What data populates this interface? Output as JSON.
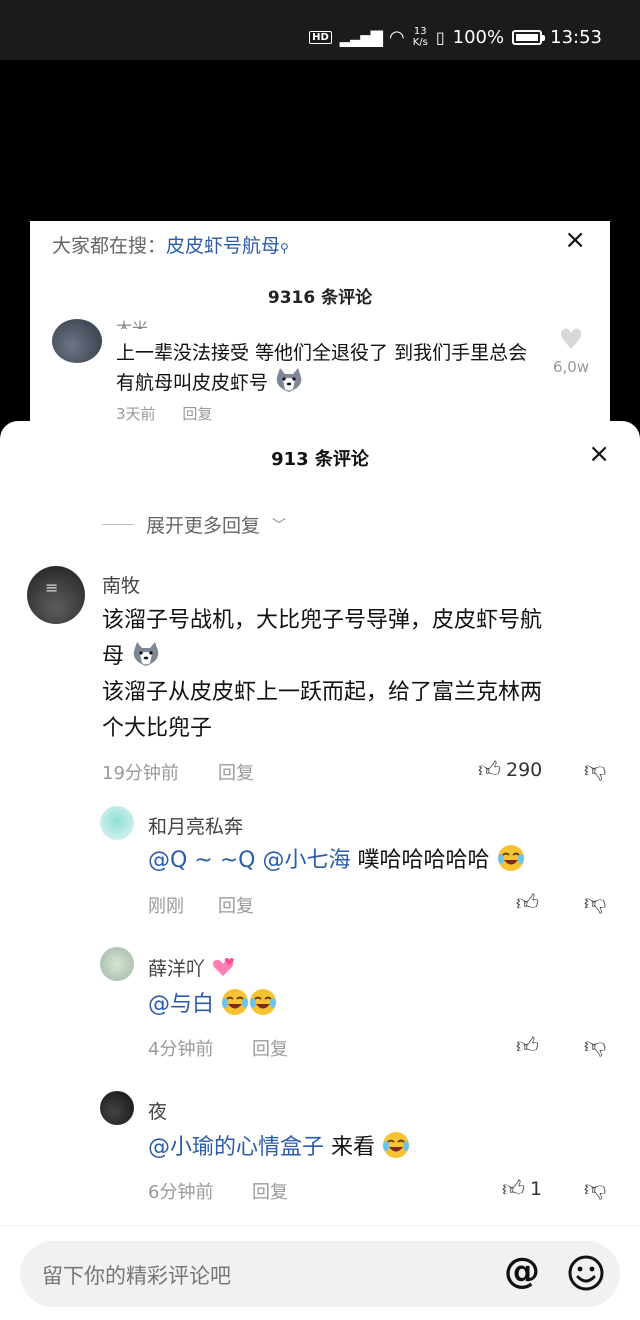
{
  "status_bar": {
    "hd": "HD",
    "signal": "5G",
    "speed_value": "13",
    "speed_unit": "K/s",
    "battery": "100%",
    "time": "13:53"
  },
  "under_panel": {
    "search_label": "大家都在搜：",
    "search_keyword": "皮皮虾号航母",
    "close": "×",
    "count": "9316 条评论",
    "comment": {
      "name": "木米",
      "text": "上一辈没法接受 等他们全退役了 到我们手里总会有航母叫皮皮虾号",
      "time": "3天前",
      "reply": "回复",
      "likes": "6,0w"
    }
  },
  "sheet": {
    "title": "913 条评论",
    "close": "×",
    "expand_more": "展开更多回复"
  },
  "comments": {
    "main": {
      "name": "南牧",
      "text_line1": "该溜子号战机，大比兜子号导弹，皮皮虾号航",
      "text_line2": "母",
      "text_line3": "该溜子从皮皮虾上一跃而起，给了富兰克林两",
      "text_line4": "个大比兜子",
      "time": "19分钟前",
      "reply": "回复",
      "likes": "290"
    },
    "replies": [
      {
        "name": "和月亮私奔",
        "mention1": "@Q ~ ~Q",
        "mention2": "@小七海",
        "text": " 噗哈哈哈哈哈",
        "time": "刚刚",
        "reply": "回复"
      },
      {
        "name": "薛洋吖",
        "mention1": "@与白",
        "time": "4分钟前",
        "reply": "回复"
      },
      {
        "name": "夜",
        "mention1": "@小瑜的心情盒子",
        "text": " 来看",
        "time": "6分钟前",
        "reply": "回复",
        "likes": "1"
      }
    ]
  },
  "input": {
    "placeholder": "留下你的精彩评论吧",
    "at": "@"
  }
}
